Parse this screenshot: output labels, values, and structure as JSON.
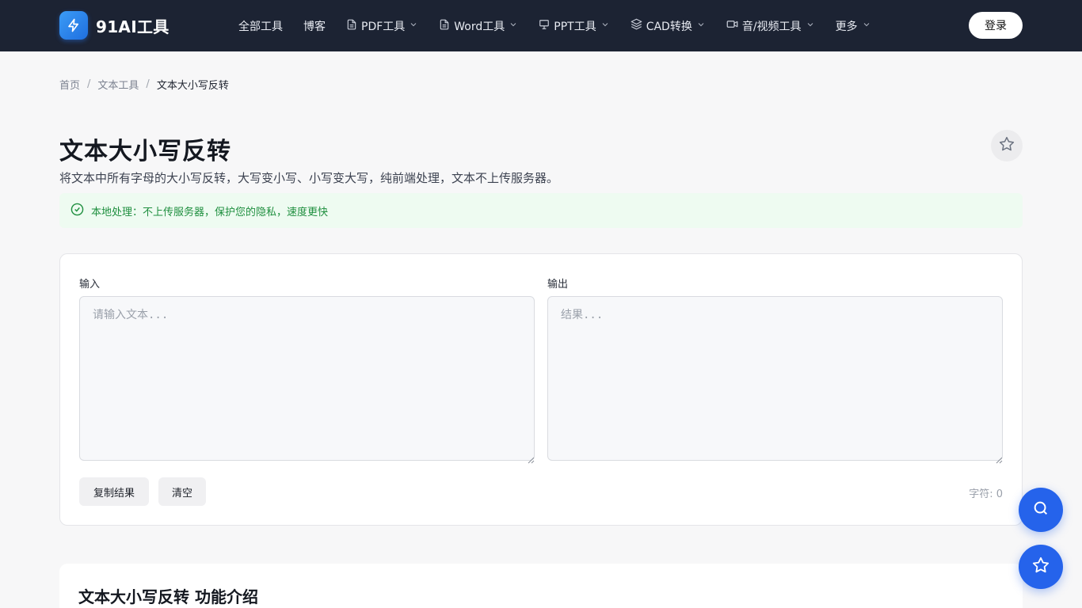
{
  "header": {
    "brand_name": "91AI工具",
    "nav": [
      {
        "label": "全部工具",
        "icon": "",
        "has_dropdown": false
      },
      {
        "label": "博客",
        "icon": "",
        "has_dropdown": false
      },
      {
        "label": "PDF工具",
        "icon": "file-icon",
        "has_dropdown": true
      },
      {
        "label": "Word工具",
        "icon": "file-icon",
        "has_dropdown": true
      },
      {
        "label": "PPT工具",
        "icon": "presentation-icon",
        "has_dropdown": true
      },
      {
        "label": "CAD转换",
        "icon": "layers-icon",
        "has_dropdown": true
      },
      {
        "label": "音/视频工具",
        "icon": "video-icon",
        "has_dropdown": true
      },
      {
        "label": "更多",
        "icon": "",
        "has_dropdown": true
      }
    ],
    "login_label": "登录"
  },
  "breadcrumb": {
    "items": [
      "首页",
      "文本工具"
    ],
    "current": "文本大小写反转",
    "separator": "/"
  },
  "page": {
    "title": "文本大小写反转",
    "description": "将文本中所有字母的大小写反转，大写变小写、小写变大写，纯前端处理，文本不上传服务器。",
    "notice": "本地处理：不上传服务器，保护您的隐私，速度更快"
  },
  "tool": {
    "input_label": "输入",
    "input_placeholder": "请输入文本...",
    "input_value": "",
    "output_label": "输出",
    "output_placeholder": "结果...",
    "output_value": "",
    "copy_button": "复制结果",
    "clear_button": "清空",
    "char_count": "字符: 0"
  },
  "intro": {
    "title": "文本大小写反转 功能介绍"
  },
  "colors": {
    "header_bg": "#1c2333",
    "accent": "#2563eb",
    "notice_bg": "#eefbf1",
    "notice_text": "#1f8f3f"
  }
}
